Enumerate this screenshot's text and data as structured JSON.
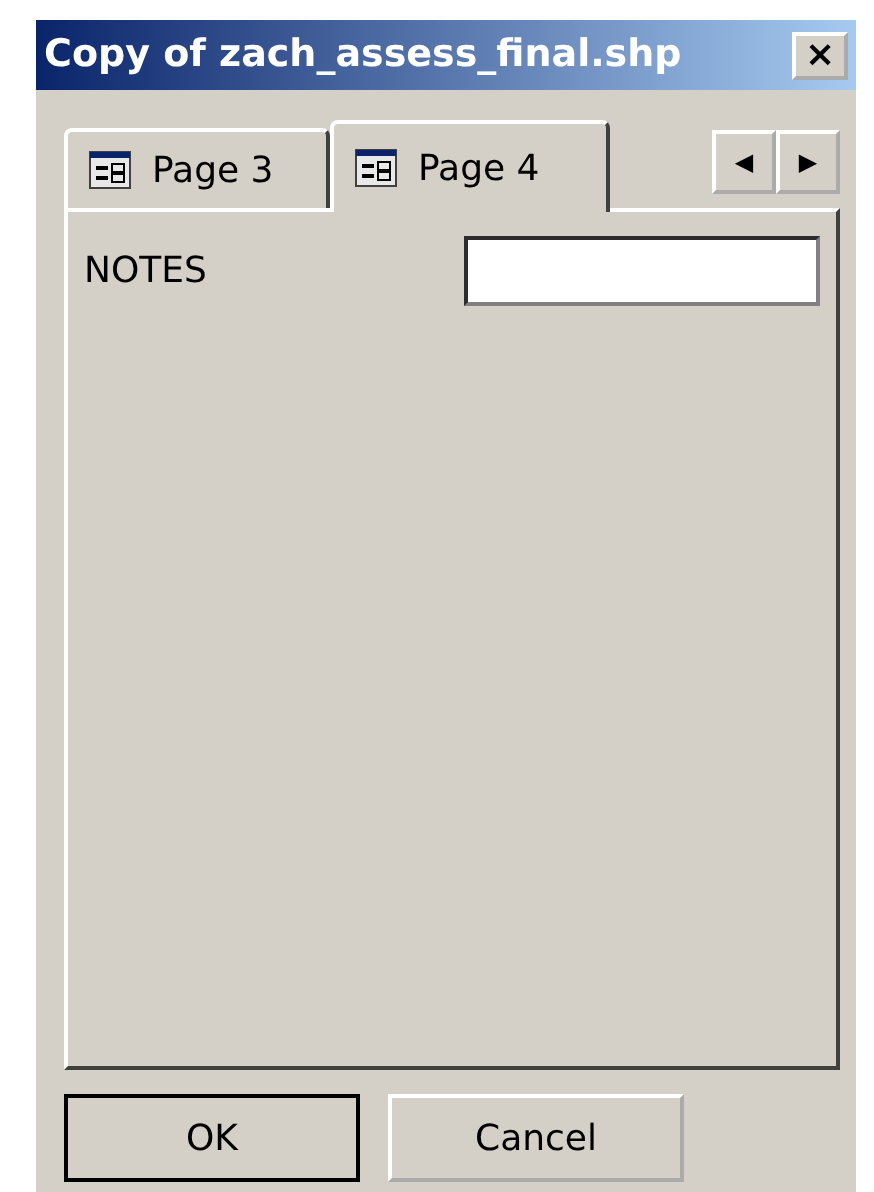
{
  "window": {
    "title": "Copy of zach_assess_final.shp",
    "close_label": "×"
  },
  "tabs": [
    {
      "label": "Page 3",
      "selected": false
    },
    {
      "label": "Page 4",
      "selected": true
    }
  ],
  "tab_scroll": [
    "◀",
    "▶"
  ],
  "fields": [
    {
      "label": "NOTES"
    }
  ],
  "buttons": [
    {
      "label": "OK",
      "default": true
    },
    {
      "label": "Cancel",
      "default": false
    }
  ]
}
